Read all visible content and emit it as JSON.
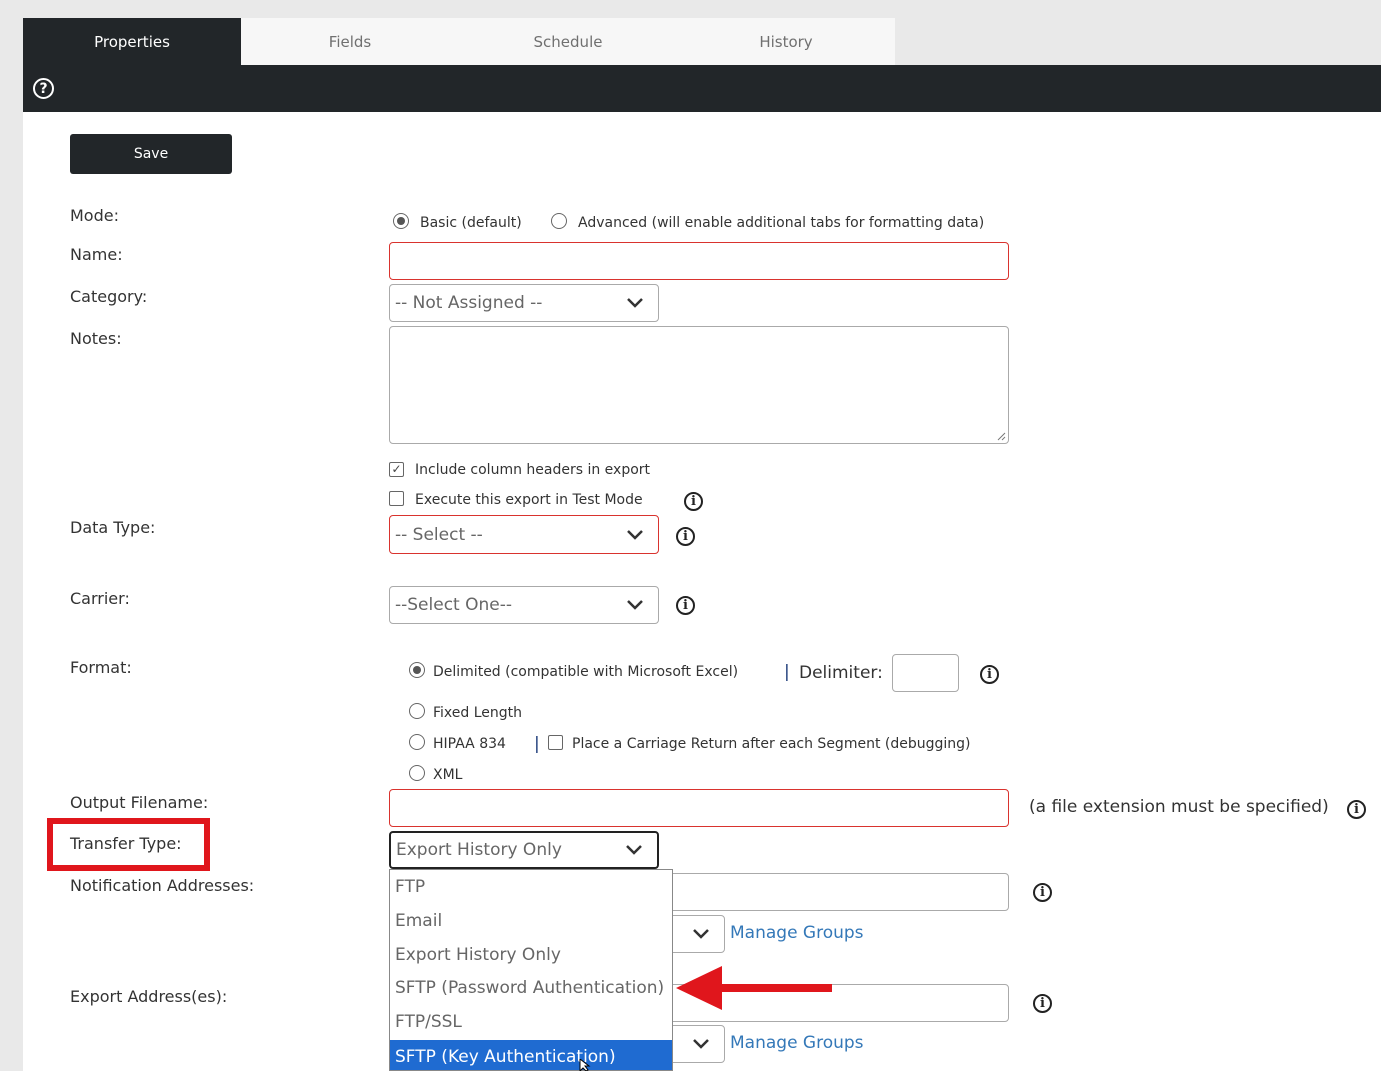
{
  "tabs": [
    {
      "label": "Properties",
      "active": true
    },
    {
      "label": "Fields",
      "active": false
    },
    {
      "label": "Schedule",
      "active": false
    },
    {
      "label": "History",
      "active": false
    }
  ],
  "toolbar": {
    "help_icon": "question-circle-icon",
    "help_glyph": "?"
  },
  "save_label": "Save",
  "form": {
    "mode": {
      "label": "Mode:",
      "options": [
        {
          "label": "Basic (default)",
          "selected": true
        },
        {
          "label": "Advanced (will enable additional tabs for formatting data)",
          "selected": false
        }
      ]
    },
    "name": {
      "label": "Name:",
      "value": ""
    },
    "category": {
      "label": "Category:",
      "value": "-- Not Assigned --"
    },
    "notes": {
      "label": "Notes:",
      "value": ""
    },
    "include_headers": {
      "label": "Include column headers in export",
      "checked": true
    },
    "test_mode": {
      "label": "Execute this export in Test Mode",
      "checked": false
    },
    "data_type": {
      "label": "Data Type:",
      "value": "-- Select --"
    },
    "carrier": {
      "label": "Carrier:",
      "value": "--Select One--"
    },
    "format": {
      "label": "Format:",
      "delimited": {
        "label": "Delimited (compatible with Microsoft Excel)",
        "selected": true
      },
      "separator": "|",
      "delimiter_label": "Delimiter:",
      "delimiter_value": "",
      "fixed_length": {
        "label": "Fixed Length",
        "selected": false
      },
      "hipaa": {
        "label": "HIPAA 834",
        "selected": false
      },
      "carriage_return": {
        "label": "Place a Carriage Return after each Segment (debugging)",
        "checked": false
      },
      "xml": {
        "label": "XML",
        "selected": false
      }
    },
    "output_filename": {
      "label": "Output Filename:",
      "value": "",
      "hint": "(a file extension must be specified)"
    },
    "transfer_type": {
      "label": "Transfer Type:",
      "value": "Export History Only"
    },
    "notification_addresses": {
      "label": "Notification Addresses:",
      "manage_groups": "Manage Groups"
    },
    "export_addresses": {
      "label": "Export Address(es):",
      "manage_groups": "Manage Groups"
    }
  },
  "dropdown": {
    "options": [
      "FTP",
      "Email",
      "Export History Only",
      "SFTP (Password Authentication)",
      "FTP/SSL",
      "SFTP (Key Authentication)"
    ],
    "highlighted": "SFTP (Key Authentication)"
  },
  "icons": {
    "info": "info-circle-icon",
    "chevron": "chevron-down-icon",
    "arrow": "red-arrow-left-icon",
    "cursor": "mouse-pointer-icon"
  },
  "colors": {
    "dark": "#222629",
    "required_border": "#d9332e",
    "selected_option": "#1f6bd1",
    "annotation": "#e0161c",
    "link": "#3478b8"
  }
}
